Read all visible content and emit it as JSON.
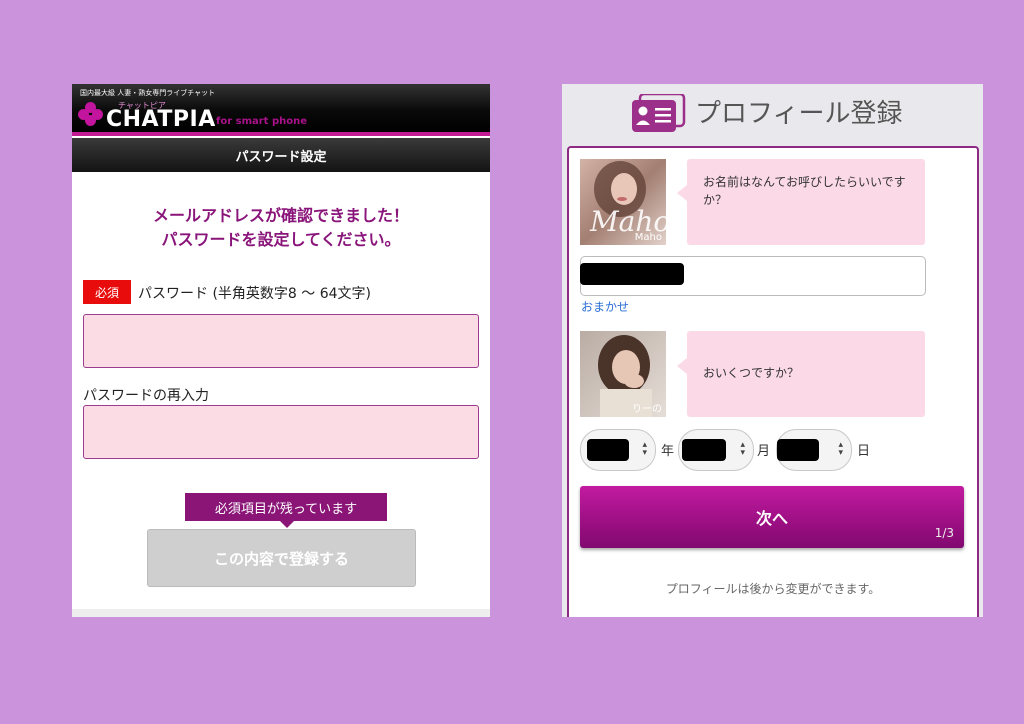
{
  "left": {
    "header": {
      "tagline": "国内最大級 人妻・熟女専門ライブチャット",
      "brand_kana": "チャットピア",
      "brand": "CHATPIA",
      "brand_sub": "for smart phone"
    },
    "title_bar": "パスワード設定",
    "confirm_line1": "メールアドレスが確認できました！",
    "confirm_line2": "パスワードを設定してください。",
    "required_badge": "必須",
    "password_label": "パスワード (半角英数字8 〜 64文字)",
    "password_value": "",
    "password_confirm_label": "パスワードの再入力",
    "password_confirm_value": "",
    "tooltip": "必須項目が残っています",
    "submit_label": "この内容で登録する"
  },
  "right": {
    "header_title": "プロフィール登録",
    "q1": {
      "avatar_name": "Maho",
      "avatar_script": "Maho",
      "text": "お名前はなんてお呼びしたらいいですか？"
    },
    "omakase_link": "おまかせ",
    "q2": {
      "avatar_name": "りーの",
      "text": "おいくつですか？"
    },
    "birth": {
      "year_unit": "年",
      "month_unit": "月",
      "day_unit": "日"
    },
    "next_label": "次へ",
    "step": "1/3",
    "note": "プロフィールは後から変更ができます。"
  },
  "colors": {
    "background": "#cb93dc",
    "accent": "#9b0f82",
    "required": "#e80c0c",
    "input_pink": "#fbdce4",
    "bubble_pink": "#fbd9e6",
    "link": "#2a6fd6"
  }
}
